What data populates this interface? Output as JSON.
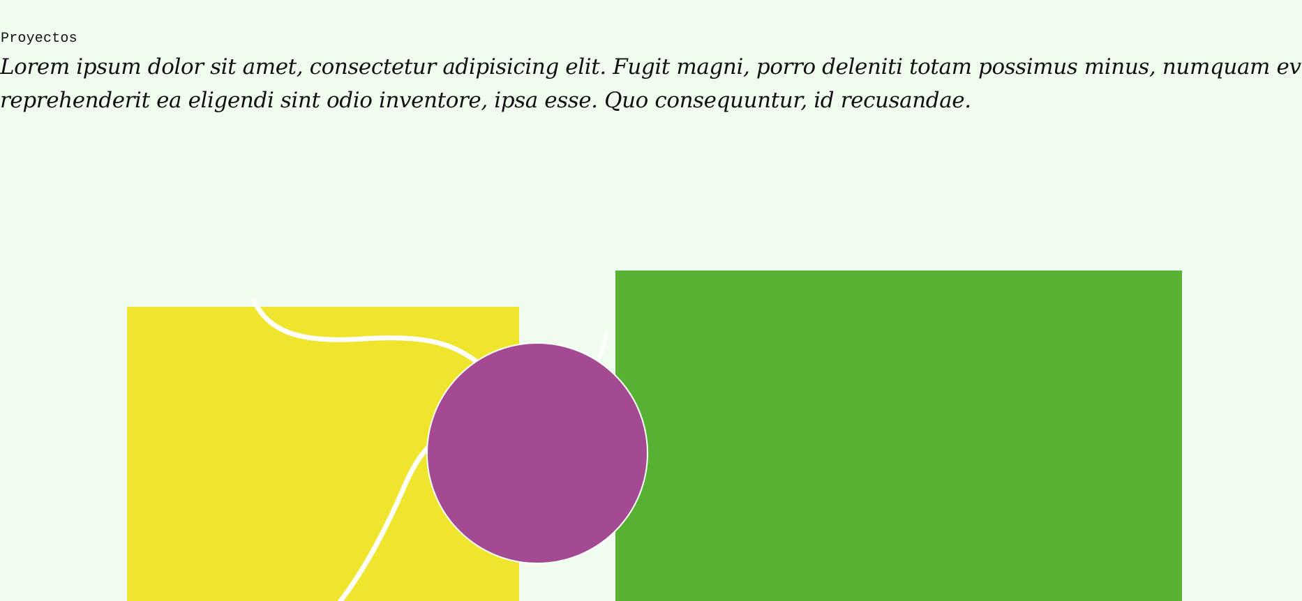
{
  "section": {
    "label": "Proyectos"
  },
  "intro": {
    "line1": "Lorem ipsum dolor sit amet, consectetur adipisicing elit. Fugit magni, porro deleniti totam possimus minus, numquam eveniet sequ",
    "line2": "reprehenderit ea eligendi sint odio inventore, ipsa esse. Quo consequuntur, id recusandae."
  },
  "colors": {
    "background": "#effcee",
    "yellow_block": "#efe52c",
    "green_block": "#57b133",
    "circle": "#a44a92",
    "curve": "#ffffff",
    "text": "#111111"
  }
}
